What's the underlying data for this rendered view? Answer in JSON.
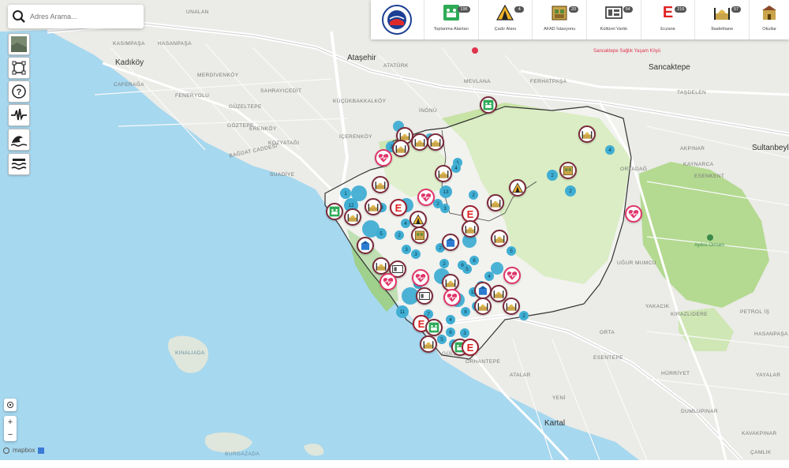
{
  "search": {
    "placeholder": "Adres Arama..."
  },
  "map": {
    "places": [
      {
        "name": "Kadıköy",
        "big": true
      },
      {
        "name": "Ataşehir",
        "big": true
      },
      {
        "name": "Sancaktepe",
        "big": true
      },
      {
        "name": "Sultanbeyli",
        "big": true
      },
      {
        "name": "Kartal",
        "big": true
      },
      {
        "name": "KINALIADA"
      },
      {
        "name": "BURGAZADA"
      },
      {
        "name": "GÜZELTEPE"
      },
      {
        "name": "TAŞDELEN"
      },
      {
        "name": "UNALAN"
      },
      {
        "name": "KASIMPAŞA"
      },
      {
        "name": "HASANPAŞA"
      },
      {
        "name": "CAFERAĞA"
      },
      {
        "name": "MERDİVENKÖY"
      },
      {
        "name": "SAHRAYICEDİT"
      },
      {
        "name": "KÜÇÜKBAKKALKÖY"
      },
      {
        "name": "FENERYOLU"
      },
      {
        "name": "GÖZTEPE"
      },
      {
        "name": "ERENKÖY"
      },
      {
        "name": "KOZYATAĞI"
      },
      {
        "name": "İÇERENKÖY"
      },
      {
        "name": "BAĞDAT CADDESİ"
      },
      {
        "name": "SUADİYE"
      },
      {
        "name": "ATATÜRK"
      },
      {
        "name": "MEVLANA"
      },
      {
        "name": "FERHATPAŞA"
      },
      {
        "name": "İNÖNÜ"
      },
      {
        "name": "AKPINAR"
      },
      {
        "name": "ORTADAĞ"
      },
      {
        "name": "KAYNARCA"
      },
      {
        "name": "ORTA"
      },
      {
        "name": "HÜRRİYET"
      },
      {
        "name": "ESENTEPE"
      },
      {
        "name": "ATALAR"
      },
      {
        "name": "YENİ"
      },
      {
        "name": "YAKACIK"
      },
      {
        "name": "ESENKENT"
      },
      {
        "name": "UĞUR MUMCU"
      },
      {
        "name": "PETROL İŞ"
      },
      {
        "name": "GÜLSUYU"
      },
      {
        "name": "ORHANTEPE"
      },
      {
        "name": "DUMLUPINAR"
      },
      {
        "name": "YAYALAR"
      },
      {
        "name": "KIRAZLIDERE"
      },
      {
        "name": "HASANPAŞA"
      },
      {
        "name": "KAVAKPINAR"
      },
      {
        "name": "ÇAMLIK"
      }
    ],
    "poi": {
      "hospital": "Sancaktepe Sağlık Yaşam Köyü",
      "park": "Aydos Ormanı"
    }
  },
  "topbar": {
    "categories": [
      {
        "label": "Toplanma Alanları",
        "count": "196",
        "icon": "assembly-area-icon"
      },
      {
        "label": "Çadır Alanı",
        "count": "4",
        "icon": "tent-icon"
      },
      {
        "label": "AFAD İstasyonu",
        "count": "20",
        "icon": "warehouse-icon"
      },
      {
        "label": "Kültürel Varlık",
        "count": "54",
        "icon": "heritage-icon"
      },
      {
        "label": "Eczane",
        "count": "216",
        "icon": "pharmacy-e-icon"
      },
      {
        "label": "İbadethane",
        "count": "57",
        "icon": "mosque-icon"
      },
      {
        "label": "Okullar",
        "count": "",
        "icon": "school-icon"
      }
    ]
  },
  "clusters": [
    {
      "n": "2"
    },
    {
      "n": "12"
    },
    {
      "n": "1"
    },
    {
      "n": "8"
    },
    {
      "n": "5"
    },
    {
      "n": "2"
    },
    {
      "n": "4"
    },
    {
      "n": "3"
    },
    {
      "n": "1"
    },
    {
      "n": "13"
    },
    {
      "n": "2"
    },
    {
      "n": "3"
    },
    {
      "n": "2"
    },
    {
      "n": "4"
    },
    {
      "n": "6"
    },
    {
      "n": "2"
    },
    {
      "n": "4"
    },
    {
      "n": "2"
    },
    {
      "n": "8"
    },
    {
      "n": "11"
    },
    {
      "n": "4"
    },
    {
      "n": "3"
    },
    {
      "n": "8"
    },
    {
      "n": "6"
    },
    {
      "n": "5"
    },
    {
      "n": "3"
    },
    {
      "n": "2"
    },
    {
      "n": "2"
    },
    {
      "n": "7"
    },
    {
      "n": "4"
    },
    {
      "n": "6"
    },
    {
      "n": "11"
    },
    {
      "n": "5"
    },
    {
      "n": "2"
    },
    {
      "n": "4"
    },
    {
      "n": "2"
    },
    {
      "n": "3"
    },
    {
      "n": "9"
    },
    {
      "n": "5"
    }
  ],
  "attribution": {
    "text": "mapbox"
  },
  "colors": {
    "sea": "#a6d8ef",
    "land": "#ebebe7",
    "park": "#c7e3a5",
    "cluster": "#41aed3"
  }
}
